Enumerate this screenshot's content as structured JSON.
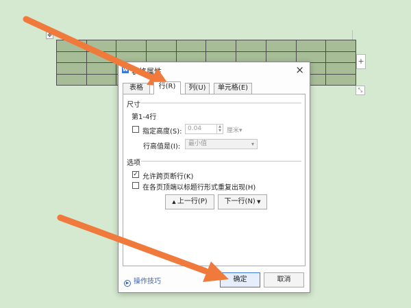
{
  "document": {
    "table_handle_icon": "move-handle-icon",
    "add_col_symbol": "+",
    "resize_symbol": "⤡"
  },
  "dialog": {
    "title": "表格属性",
    "close_symbol": "×",
    "tabs": [
      {
        "label": "表格(T)"
      },
      {
        "label": "行(R)"
      },
      {
        "label": "列(U)"
      },
      {
        "label": "单元格(E)"
      }
    ],
    "size_section": {
      "title": "尺寸",
      "rows_label": "第1-4行",
      "specify_height_label": "指定高度(S):",
      "specify_height_checked": false,
      "height_value": "0.04",
      "unit": "厘米",
      "row_height_is_label": "行高值是(I):",
      "row_height_is_value": "最小值"
    },
    "options_section": {
      "title": "选项",
      "allow_break_label": "允许跨页断行(K)",
      "allow_break_checked": true,
      "repeat_header_label": "在各页顶端以标题行形式重复出现(H)",
      "repeat_header_checked": false
    },
    "prev_row_label": "上一行(P)",
    "next_row_label": "下一行(N)",
    "tips_label": "操作技巧",
    "ok_label": "确定",
    "cancel_label": "取消"
  },
  "annotation": {
    "arrow_color": "#f07a3c"
  }
}
